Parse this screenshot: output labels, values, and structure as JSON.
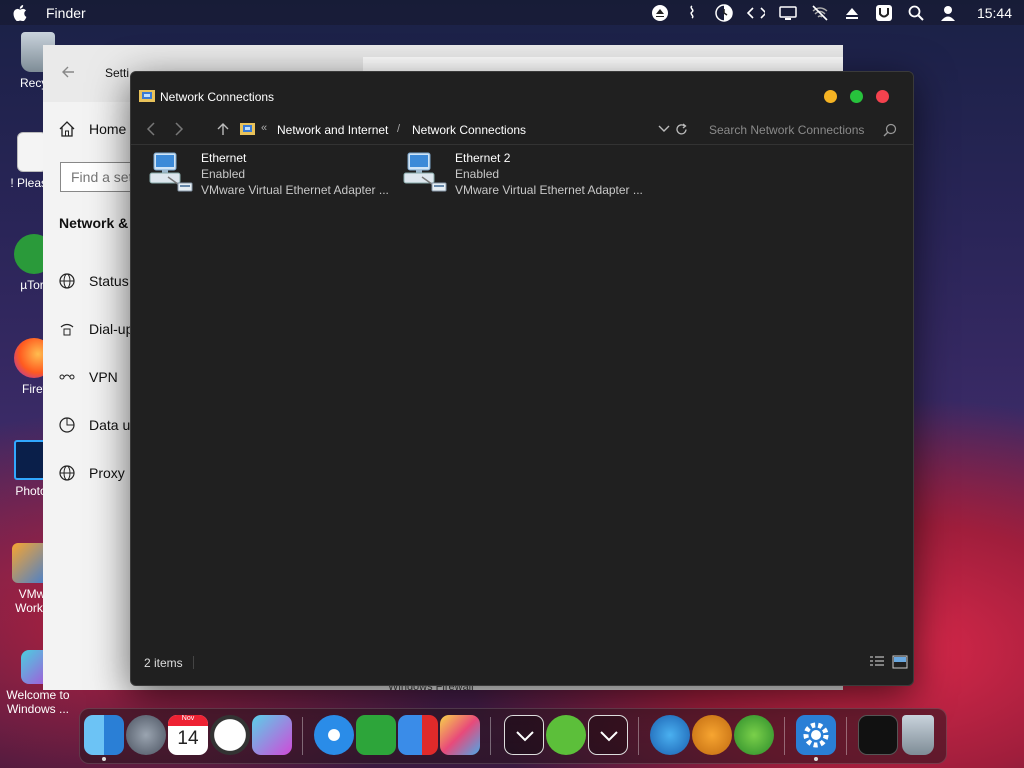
{
  "menubar": {
    "app_name": "Finder",
    "clock": "15:44",
    "status_icons": [
      "eject-icon",
      "network-icon",
      "half-circle-icon",
      "code-icon",
      "display-icon",
      "no-wifi-icon",
      "eject-up-icon",
      "u-icon",
      "search-icon",
      "user-icon"
    ]
  },
  "desktop": {
    "icons": [
      {
        "label": "Recycl",
        "icon": "recycle-bin-icon"
      },
      {
        "label": "! Please",
        "icon": "notepad-icon"
      },
      {
        "label": "µTorr",
        "icon": "utorrent-icon"
      },
      {
        "label": "Firef",
        "icon": "firefox-icon"
      },
      {
        "label": "Photos",
        "icon": "photoshop-icon"
      },
      {
        "label": "VMw",
        "label2": "Works",
        "icon": "vmware-icon"
      },
      {
        "label": "Welcome to",
        "label2": "Windows ...",
        "icon": "welcome-icon"
      }
    ]
  },
  "settings_window": {
    "title": "Setti",
    "home": "Home",
    "search_placeholder": "Find a set",
    "section_heading": "Network &",
    "nav": [
      {
        "label": "Status",
        "icon": "globe-icon"
      },
      {
        "label": "Dial-up",
        "icon": "phone-icon"
      },
      {
        "label": "VPN",
        "icon": "vpn-icon"
      },
      {
        "label": "Data u",
        "icon": "data-usage-icon"
      },
      {
        "label": "Proxy",
        "icon": "globe-icon"
      }
    ],
    "footer_text": "Windows Firewall"
  },
  "explorer": {
    "title": "Network Connections",
    "breadcrumb": {
      "overflow": "«",
      "parent": "Network and Internet",
      "separator": "/",
      "current": "Network Connections"
    },
    "search_placeholder": "Search Network Connections",
    "items": [
      {
        "name": "Ethernet",
        "status": "Enabled",
        "adapter": "VMware Virtual Ethernet Adapter ..."
      },
      {
        "name": "Ethernet 2",
        "status": "Enabled",
        "adapter": "VMware Virtual Ethernet Adapter ..."
      }
    ],
    "status_count": "2 items"
  },
  "dock": {
    "calendar_month": "Nov",
    "calendar_day": "14",
    "apps": [
      "finder-icon",
      "launchpad-icon",
      "calendar-icon",
      "clock-icon",
      "photo-booth-icon",
      "safari-icon",
      "utorrent-icon",
      "parallels-icon",
      "photos-icon",
      "chevron-down-icon",
      "link-icon",
      "chevron-down-icon",
      "www-icon",
      "download-icon",
      "dots-icon",
      "settings-icon",
      "terminal-icon",
      "trash-icon"
    ]
  },
  "colors": {
    "traffic_yellow": "#f5b323",
    "traffic_green": "#27c23c",
    "traffic_red": "#f4424e",
    "explorer_bg": "#202020"
  }
}
